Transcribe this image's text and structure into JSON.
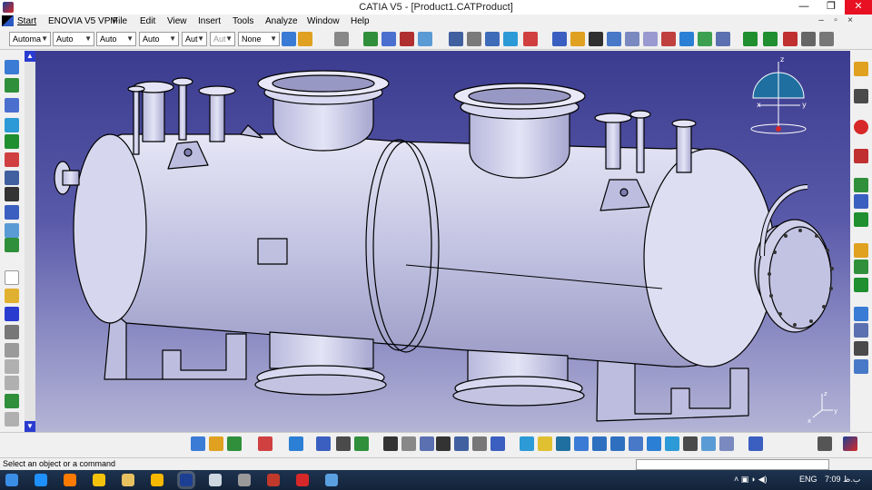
{
  "window": {
    "title": "CATIA V5 - [Product1.CATProduct]",
    "controls": {
      "minimize": "—",
      "maximize": "❐",
      "close": "✕"
    }
  },
  "menu": {
    "items": [
      "Start",
      "ENOVIA V5 VPM",
      "File",
      "Edit",
      "View",
      "Insert",
      "Tools",
      "Analyze",
      "Window",
      "Help"
    ],
    "inner_controls": {
      "minimize": "–",
      "restore": "▫",
      "close": "×"
    }
  },
  "properties_toolbar": {
    "combos": [
      {
        "value": "Automa",
        "disabled": false
      },
      {
        "value": "Auto",
        "disabled": false
      },
      {
        "value": "Auto",
        "disabled": false
      },
      {
        "value": "Auto",
        "disabled": false
      },
      {
        "value": "Aut",
        "disabled": false
      },
      {
        "value": "Aut",
        "disabled": true
      },
      {
        "value": "None",
        "disabled": false
      }
    ]
  },
  "compass": {
    "axis_x": "x",
    "axis_y": "y",
    "axis_z": "z"
  },
  "mini_axis": {
    "axis_x": "x",
    "axis_y": "y",
    "axis_z": "z"
  },
  "status_bar": {
    "message": "Select an object or a command"
  },
  "taskbar": {
    "language": "ENG",
    "time": "7:09 ب.ظ"
  },
  "colors": {
    "viewport_top": "#3b3b8f",
    "viewport_bottom": "#b4b4d6",
    "model_fill": "#c9c9e6",
    "model_edge": "#000000",
    "scrollbar_accent": "#2a3bd0",
    "close_button": "#e81123"
  }
}
